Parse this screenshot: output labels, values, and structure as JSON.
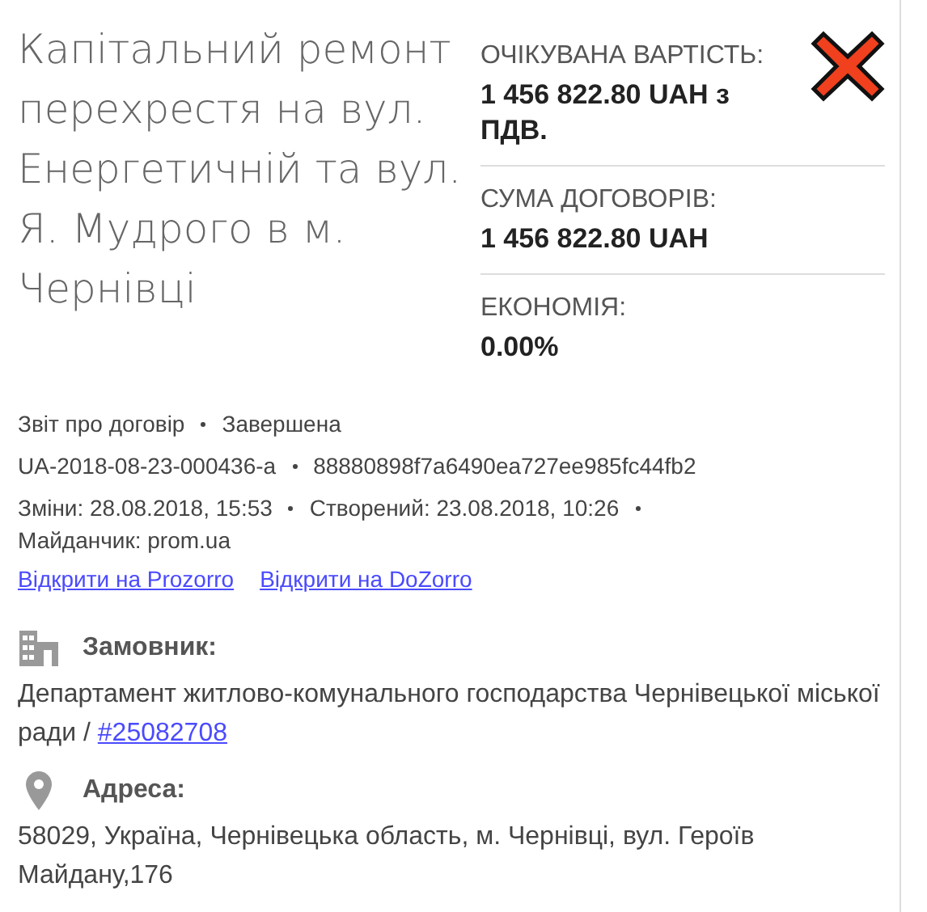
{
  "title": "Капітальний ремонт перехрестя на вул. Енергетичній та вул. Я. Мудрого в м. Чернівці",
  "status_icon": {
    "kind": "cross"
  },
  "stats": [
    {
      "label": "ОЧІКУВАНА ВАРТІСТЬ:",
      "value": "1 456 822.80 UAH з ПДВ."
    },
    {
      "label": "СУМА ДОГОВОРІВ:",
      "value": "1 456 822.80 UAH"
    },
    {
      "label": "ЕКОНОМІЯ:",
      "value": "0.00%"
    }
  ],
  "meta": [
    [
      "Звіт про договір",
      "Завершена"
    ],
    [
      "UA-2018-08-23-000436-a",
      "88880898f7a6490ea727ee985fc44fb2"
    ],
    [
      "Зміни: 28.08.2018, 15:53",
      "Створений: 23.08.2018, 10:26",
      "Майданчик: prom.ua"
    ]
  ],
  "links": [
    "Відкрити на Prozorro",
    "Відкрити на DoZorro"
  ],
  "sections": [
    {
      "kind": "building",
      "heading": "Замовник:",
      "text": "Департамент житлово-комунального господарства Чернівецької міської ради / ",
      "link": "#25082708"
    },
    {
      "kind": "pin",
      "heading": "Адреса:",
      "text": "58029, Україна, Чернівецька область, м. Чернівці, вул. Героїв Майдану,176"
    }
  ]
}
